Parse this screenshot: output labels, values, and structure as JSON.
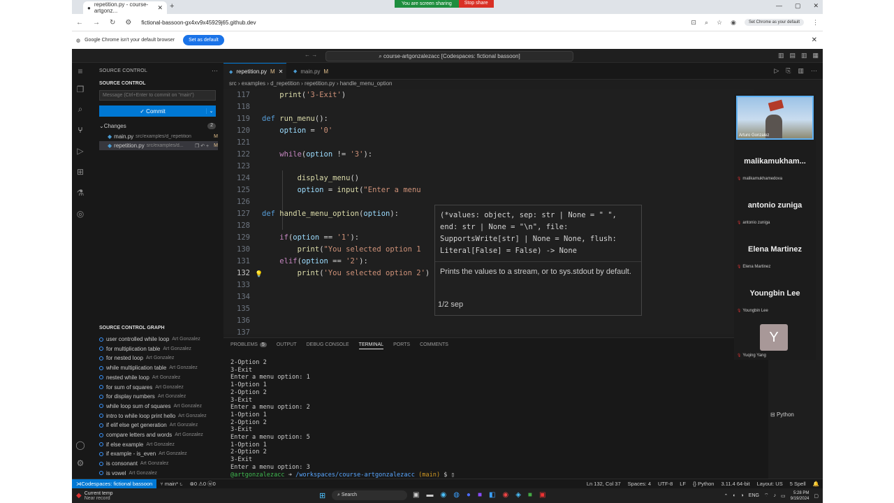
{
  "share": {
    "message": "You are screen sharing",
    "stop": "Stop share"
  },
  "browser": {
    "tab_title": "repetition.py - course-artgonz...",
    "url": "fictional-bassoon-gx4xv9x45929j65.github.dev",
    "default_pill": "Set Chrome as your default",
    "infobar_text": "Google Chrome isn't your default browser",
    "infobar_button": "Set as default"
  },
  "vscode": {
    "title": "course-artgonzalezacc [Codespaces: fictional bassoon]",
    "sidebar": {
      "title": "SOURCE CONTROL",
      "section": "SOURCE CONTROL",
      "commit_placeholder": "Message (Ctrl+Enter to commit on \"main\")",
      "commit_label": "✓ Commit",
      "changes_label": "Changes",
      "changes_count": "2",
      "files": [
        {
          "name": "main.py",
          "path": "src/examples/d_repetition",
          "status": "M"
        },
        {
          "name": "repetition.py",
          "path": "src/examples/d...",
          "status": "M"
        }
      ],
      "graph_title": "SOURCE CONTROL GRAPH",
      "graph": [
        {
          "msg": "user controlled while loop",
          "author": "Art Gonzalez"
        },
        {
          "msg": "for multiplication table",
          "author": "Art Gonzalez"
        },
        {
          "msg": "for nested loop",
          "author": "Art Gonzalez"
        },
        {
          "msg": "while multiplication table",
          "author": "Art Gonzalez"
        },
        {
          "msg": "nested while loop",
          "author": "Art Gonzalez"
        },
        {
          "msg": "for sum of squares",
          "author": "Art Gonzalez"
        },
        {
          "msg": "for display numbers",
          "author": "Art Gonzalez"
        },
        {
          "msg": "while loop sum of squares",
          "author": "Art Gonzalez"
        },
        {
          "msg": "intro to while loop print hello",
          "author": "Art Gonzalez"
        },
        {
          "msg": "if elif else get generation",
          "author": "Art Gonzalez"
        },
        {
          "msg": "compare letters and words",
          "author": "Art Gonzalez"
        },
        {
          "msg": "if else example",
          "author": "Art Gonzalez"
        },
        {
          "msg": "if example - is_even",
          "author": "Art Gonzalez"
        },
        {
          "msg": "is consonant",
          "author": "Art Gonzalez"
        },
        {
          "msg": "is vowel",
          "author": "Art Gonzalez"
        }
      ]
    },
    "tabs": [
      {
        "label": "repetition.py",
        "status": "M"
      },
      {
        "label": "main.py",
        "status": "M"
      }
    ],
    "breadcrumb": "src › examples › d_repetition › repetition.py › handle_menu_option",
    "lines": [
      "117",
      "118",
      "119",
      "120",
      "121",
      "122",
      "123",
      "124",
      "125",
      "126",
      "127",
      "128",
      "129",
      "130",
      "131",
      "132",
      "133",
      "134",
      "135",
      "136",
      "137"
    ],
    "hover": {
      "signature": "(*values: object, sep: str | None = \" \", end: str | None = \"\\n\", file: SupportsWrite[str] | None = None, flush: Literal[False] = False) -> None",
      "doc": "Prints the values to a stream, or to sys.stdout by default.",
      "pager": "1/2",
      "param": "sep"
    },
    "panel": {
      "tabs": [
        "PROBLEMS",
        "OUTPUT",
        "DEBUG CONSOLE",
        "TERMINAL",
        "PORTS",
        "COMMENTS"
      ],
      "problems_count": "5",
      "terminal": "2-Option 2\n3-Exit\nEnter a menu option: 1\n1-Option 1\n2-Option 2\n3-Exit\nEnter a menu option: 2\n1-Option 1\n2-Option 2\n3-Exit\nEnter a menu option: 5\n1-Option 1\n2-Option 2\n3-Exit\nEnter a menu option: 3",
      "prompt_user": "@artgonzalezacc",
      "prompt_path": "/workspaces/course-artgonzalezacc",
      "prompt_branch": "(main)"
    },
    "statusbar": {
      "remote": "Codespaces: fictional bassoon",
      "branch": "main*",
      "problems": "⊗0 ⚠0 ⓦ0",
      "right": [
        "Ln 132, Col 37",
        "Spaces: 4",
        "UTF-8",
        "LF",
        "{} Python",
        "3.11.4 64-bit",
        "Layout: US",
        "5 Spell"
      ]
    }
  },
  "participants": [
    {
      "name": "malikamukham...",
      "sub": "malikamukhamedova"
    },
    {
      "name": "antonio zuniga",
      "sub": "antonio zuniga"
    },
    {
      "name": "Elena Martinez",
      "sub": "Elena Martinez"
    },
    {
      "name": "Youngbin Lee",
      "sub": "Youngbin Lee"
    }
  ],
  "video_name": "Arturo Gonzalez",
  "avatar_letter": "Y",
  "avatar_name": "Yuqing Yang",
  "python_side": "Python",
  "taskbar": {
    "weather_temp": "Current temp",
    "weather_sub": "Near record",
    "search": "Search",
    "lang": "ENG",
    "time": "5:28 PM",
    "date": "9/19/2024"
  }
}
